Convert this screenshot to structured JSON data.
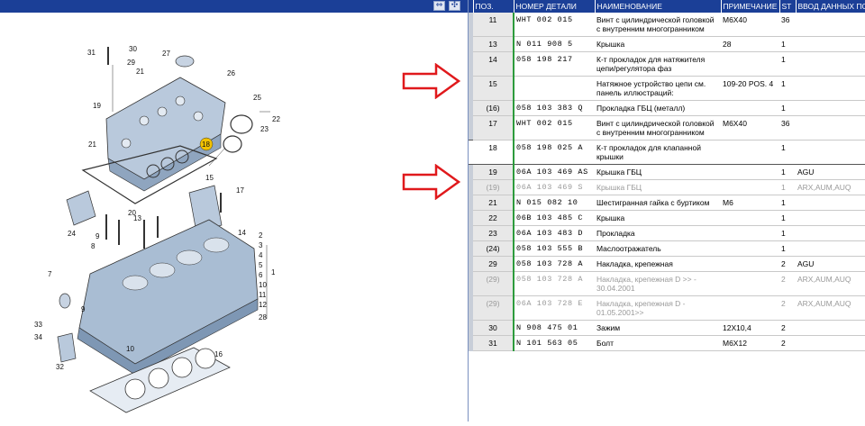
{
  "toolbar": {
    "buttons": [
      "⇔",
      "✣"
    ]
  },
  "diagram": {
    "callouts": [
      "30",
      "31",
      "29",
      "27",
      "21",
      "26",
      "25",
      "22",
      "23",
      "19",
      "21",
      "18",
      "20",
      "17",
      "15",
      "24",
      "13",
      "14",
      "9",
      "8",
      "2",
      "3",
      "4",
      "5",
      "6",
      "7",
      "10",
      "11",
      "12",
      "28",
      "1",
      "33",
      "34",
      "32",
      "10",
      "16"
    ],
    "highlight_label": "18",
    "highlight_color": "#f2c200"
  },
  "table": {
    "headers": [
      "ПОЗ.",
      "НОМЕР ДЕТАЛИ",
      "НАИМЕНОВАНИЕ",
      "ПРИМЕЧАНИЕ",
      "ST",
      "ВВОД ДАННЫХ ПО"
    ],
    "rows": [
      {
        "pos": "11",
        "part": "WHT 002 015",
        "name": "Винт с цилиндрической головкой с внутренним многогранником",
        "note": "M6X40",
        "st": "36",
        "data": "",
        "state": "normal"
      },
      {
        "pos": "13",
        "part": "N    011 908 5",
        "name": "Крышка",
        "note": "28",
        "st": "1",
        "data": "",
        "state": "normal"
      },
      {
        "pos": "14",
        "part": "058 198 217",
        "name": "К-т прокладок для натяжителя цепи/регулятора фаз",
        "note": "",
        "st": "1",
        "data": "",
        "state": "normal"
      },
      {
        "pos": "15",
        "part": "",
        "name": "Натяжное устройство цепи  см. панель иллюстраций:",
        "note": "109-20 POS.  4",
        "st": "1",
        "data": "",
        "state": "normal"
      },
      {
        "pos": "(16)",
        "part": "058 103 383 Q",
        "name": "Прокладка ГБЦ (металл)",
        "note": "",
        "st": "1",
        "data": "",
        "state": "normal"
      },
      {
        "pos": "17",
        "part": "WHT 002 015",
        "name": "Винт с цилиндрической головкой с внутренним многогранником",
        "note": "M6X40",
        "st": "36",
        "data": "",
        "state": "normal"
      },
      {
        "pos": "18",
        "part": "058 198 025 A",
        "name": "К-т прокладок для клапанной крышки",
        "note": "",
        "st": "1",
        "data": "",
        "state": "selected"
      },
      {
        "pos": "19",
        "part": "06A 103 469 AS",
        "name": "Крышка ГБЦ",
        "note": "",
        "st": "1",
        "data": "AGU",
        "state": "normal"
      },
      {
        "pos": "(19)",
        "part": "06A 103 469 S",
        "name": "Крышка ГБЦ",
        "note": "",
        "st": "1",
        "data": "ARX,AUM,AUQ",
        "state": "faded"
      },
      {
        "pos": "21",
        "part": "N    015 082 10",
        "name": "Шестигранная гайка с буртиком",
        "note": "M6",
        "st": "1",
        "data": "",
        "state": "normal"
      },
      {
        "pos": "22",
        "part": "06B 103 485 C",
        "name": "Крышка",
        "note": "",
        "st": "1",
        "data": "",
        "state": "normal"
      },
      {
        "pos": "23",
        "part": "06A 103 483 D",
        "name": "Прокладка",
        "note": "",
        "st": "1",
        "data": "",
        "state": "normal"
      },
      {
        "pos": "(24)",
        "part": "058 103 555 B",
        "name": "Маслоотражатель",
        "note": "",
        "st": "1",
        "data": "",
        "state": "normal"
      },
      {
        "pos": "29",
        "part": "058 103 728 A",
        "name": "Накладка, крепежная",
        "note": "",
        "st": "2",
        "data": "AGU",
        "state": "normal"
      },
      {
        "pos": "(29)",
        "part": "058 103 728 A",
        "name": "Накладка, крепежная D            >> - 30.04.2001",
        "note": "",
        "st": "2",
        "data": "ARX,AUM,AUQ",
        "state": "faded"
      },
      {
        "pos": "(29)",
        "part": "06A 103 728 E",
        "name": "Накладка, крепежная D - 01.05.2001>>",
        "note": "",
        "st": "2",
        "data": "ARX,AUM,AUQ",
        "state": "faded"
      },
      {
        "pos": "30",
        "part": "N    908 475 01",
        "name": "Зажим",
        "note": "12X10,4",
        "st": "2",
        "data": "",
        "state": "normal"
      },
      {
        "pos": "31",
        "part": "N    101 563 05",
        "name": "Болт",
        "note": "M6X12",
        "st": "2",
        "data": "",
        "state": "normal"
      }
    ]
  }
}
